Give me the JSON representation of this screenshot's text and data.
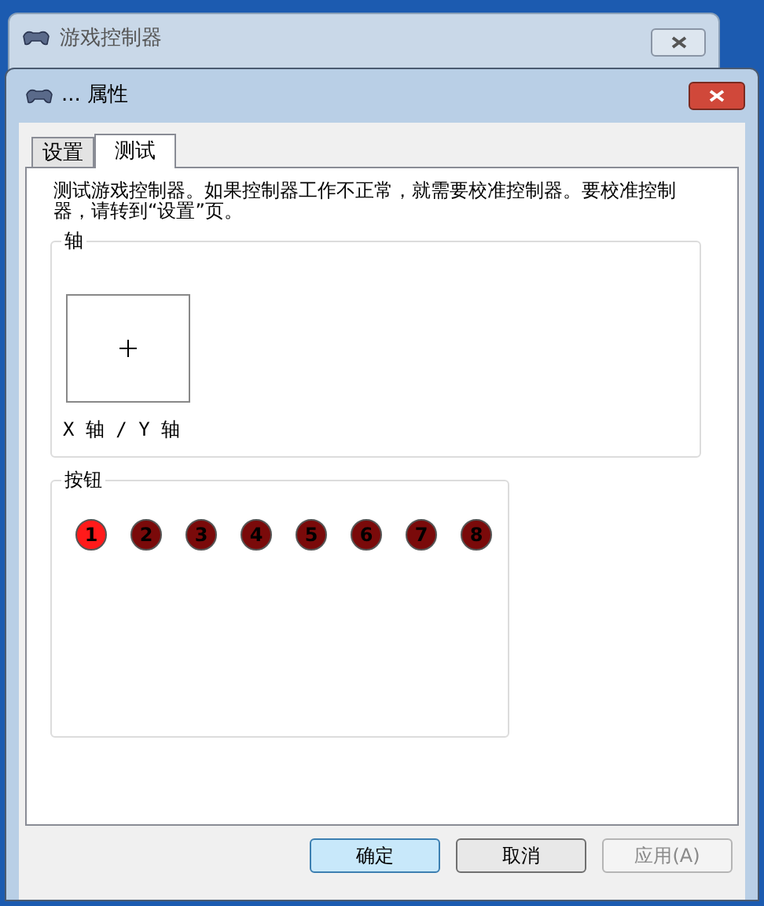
{
  "back_window": {
    "title": "游戏控制器"
  },
  "dialog": {
    "title": "... 属性"
  },
  "tabs": [
    {
      "label": "设置",
      "selected": false
    },
    {
      "label": "测试",
      "selected": true
    }
  ],
  "description": "测试游戏控制器。如果控制器工作不正常，就需要校准控制器。要校准控制器，请转到“设置”页。",
  "axes": {
    "title": "轴",
    "label": "X 轴 / Y 轴"
  },
  "buttons_group": {
    "title": "按钮",
    "buttons": [
      {
        "label": "1",
        "on": true
      },
      {
        "label": "2",
        "on": false
      },
      {
        "label": "3",
        "on": false
      },
      {
        "label": "4",
        "on": false
      },
      {
        "label": "5",
        "on": false
      },
      {
        "label": "6",
        "on": false
      },
      {
        "label": "7",
        "on": false
      },
      {
        "label": "8",
        "on": false
      }
    ]
  },
  "dialog_buttons": [
    {
      "label": "确定",
      "default": true,
      "disabled": false
    },
    {
      "label": "取消",
      "default": false,
      "disabled": false
    },
    {
      "label": "应用(A)",
      "default": false,
      "disabled": true
    }
  ]
}
